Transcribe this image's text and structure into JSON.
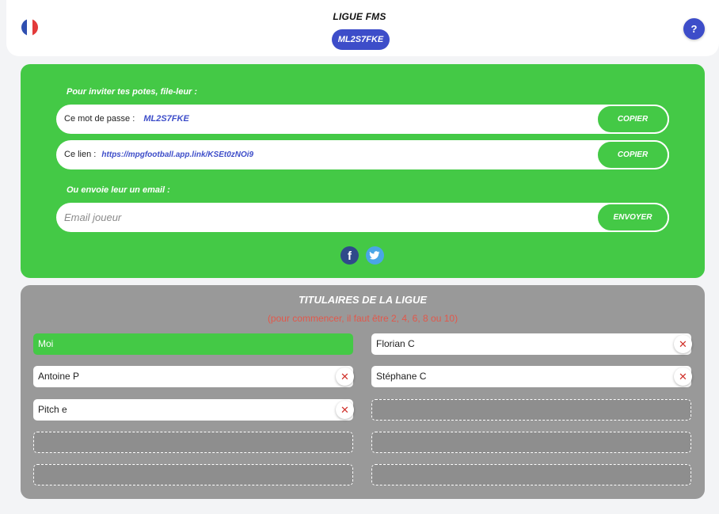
{
  "header": {
    "league_title": "LIGUE FMS",
    "league_code": "ML2S7FKE",
    "help_label": "?",
    "flag_colors": [
      "#2f4fb0",
      "#ffffff",
      "#e33a3a"
    ]
  },
  "invite": {
    "heading": "Pour inviter tes potes, file-leur :",
    "password_label": "Ce mot de passe :",
    "password_value": "ML2S7FKE",
    "copy_label": "COPIER",
    "link_label": "Ce lien :",
    "link_value": "https://mpgfootball.app.link/KSEt0zNOi9",
    "copy_link_label": "COPIER",
    "email_heading": "Ou envoie leur un email :",
    "email_placeholder": "Email joueur",
    "send_label": "ENVOYER",
    "social": {
      "facebook_glyph": "f",
      "twitter_glyph": "🐦"
    }
  },
  "roster": {
    "title": "TITULAIRES DE LA LIGUE",
    "subtitle": "(pour commencer, il faut être 2, 4, 6, 8 ou 10)",
    "remove_glyph": "✕",
    "players": [
      "Moi",
      "Florian C",
      "Antoine P",
      "Stéphane C",
      "Pitch e"
    ]
  },
  "colors": {
    "accent": "#3d4dc9",
    "green": "#44c946",
    "gray": "#999999",
    "warning": "#e2584b"
  }
}
